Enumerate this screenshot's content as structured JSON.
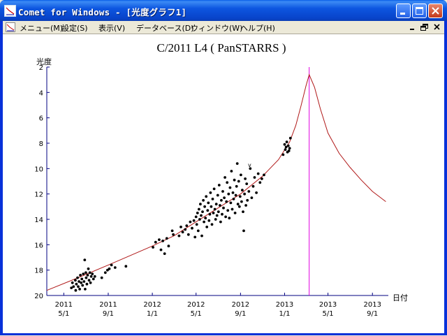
{
  "window": {
    "title": "Comet for Windows - [光度グラフ1]",
    "controls": {
      "minimize": "minimize",
      "maximize": "maximize",
      "close": "close"
    }
  },
  "menubar": {
    "items": [
      {
        "label": "メニュー(M)"
      },
      {
        "label": "設定(S)"
      },
      {
        "label": "表示(V)"
      },
      {
        "label": "データベース(D)"
      },
      {
        "label": "ウィンドウ(W)"
      },
      {
        "label": "ヘルプ(H)"
      }
    ]
  },
  "chart_data": {
    "type": "scatter",
    "title": "C/2011 L4 ( PanSTARRS )",
    "ylabel": "光度",
    "xlabel": "日付",
    "y_inverted": true,
    "ylim": [
      20,
      2
    ],
    "y_ticks": [
      2,
      4,
      6,
      8,
      10,
      12,
      14,
      16,
      18,
      20
    ],
    "xlim": [
      "2011-03-15",
      "2013-10-15"
    ],
    "x_ticks": [
      {
        "date": "2011-05-01",
        "year": "2011",
        "md": "5/1"
      },
      {
        "date": "2011-09-01",
        "year": "2011",
        "md": "9/1"
      },
      {
        "date": "2012-01-01",
        "year": "2012",
        "md": "1/1"
      },
      {
        "date": "2012-05-01",
        "year": "2012",
        "md": "5/1"
      },
      {
        "date": "2012-09-01",
        "year": "2012",
        "md": "9/1"
      },
      {
        "date": "2013-01-01",
        "year": "2013",
        "md": "1/1"
      },
      {
        "date": "2013-05-01",
        "year": "2013",
        "md": "5/1"
      },
      {
        "date": "2013-09-01",
        "year": "2013",
        "md": "9/1"
      }
    ],
    "perihelion_marker": {
      "date": "2013-03-10",
      "color": "#E000E0"
    },
    "curve": {
      "color": "#B01818",
      "points": [
        {
          "x": "2011-03-15",
          "y": 19.6
        },
        {
          "x": "2011-06-01",
          "y": 18.7
        },
        {
          "x": "2011-09-01",
          "y": 17.6
        },
        {
          "x": "2012-01-01",
          "y": 16.1
        },
        {
          "x": "2012-03-01",
          "y": 15.3
        },
        {
          "x": "2012-05-01",
          "y": 14.2
        },
        {
          "x": "2012-07-01",
          "y": 13.1
        },
        {
          "x": "2012-09-01",
          "y": 12.0
        },
        {
          "x": "2012-11-01",
          "y": 10.6
        },
        {
          "x": "2012-12-15",
          "y": 9.3
        },
        {
          "x": "2013-01-15",
          "y": 7.9
        },
        {
          "x": "2013-02-01",
          "y": 6.6
        },
        {
          "x": "2013-02-15",
          "y": 5.1
        },
        {
          "x": "2013-03-01",
          "y": 3.5
        },
        {
          "x": "2013-03-10",
          "y": 2.6
        },
        {
          "x": "2013-03-25",
          "y": 3.6
        },
        {
          "x": "2013-04-10",
          "y": 5.3
        },
        {
          "x": "2013-05-01",
          "y": 7.2
        },
        {
          "x": "2013-06-01",
          "y": 8.8
        },
        {
          "x": "2013-07-01",
          "y": 9.9
        },
        {
          "x": "2013-08-01",
          "y": 10.9
        },
        {
          "x": "2013-09-01",
          "y": 11.8
        },
        {
          "x": "2013-10-08",
          "y": 12.6
        }
      ]
    },
    "observations": [
      {
        "x": "2011-05-22",
        "y": 19.4
      },
      {
        "x": "2011-05-25",
        "y": 19.0
      },
      {
        "x": "2011-05-28",
        "y": 19.3
      },
      {
        "x": "2011-06-02",
        "y": 18.8
      },
      {
        "x": "2011-06-03",
        "y": 19.6
      },
      {
        "x": "2011-06-05",
        "y": 19.1
      },
      {
        "x": "2011-06-08",
        "y": 18.6
      },
      {
        "x": "2011-06-10",
        "y": 19.3
      },
      {
        "x": "2011-06-12",
        "y": 18.9
      },
      {
        "x": "2011-06-14",
        "y": 19.5
      },
      {
        "x": "2011-06-16",
        "y": 18.4
      },
      {
        "x": "2011-06-18",
        "y": 19.0
      },
      {
        "x": "2011-06-20",
        "y": 18.7
      },
      {
        "x": "2011-06-22",
        "y": 19.2
      },
      {
        "x": "2011-06-24",
        "y": 18.3
      },
      {
        "x": "2011-06-26",
        "y": 18.9
      },
      {
        "x": "2011-06-28",
        "y": 17.2
      },
      {
        "x": "2011-06-29",
        "y": 19.5
      },
      {
        "x": "2011-07-01",
        "y": 18.2
      },
      {
        "x": "2011-07-02",
        "y": 18.6
      },
      {
        "x": "2011-07-04",
        "y": 19.1
      },
      {
        "x": "2011-07-06",
        "y": 18.4
      },
      {
        "x": "2011-07-08",
        "y": 17.9
      },
      {
        "x": "2011-07-10",
        "y": 18.8
      },
      {
        "x": "2011-07-12",
        "y": 18.2
      },
      {
        "x": "2011-07-14",
        "y": 19.0
      },
      {
        "x": "2011-07-16",
        "y": 18.5
      },
      {
        "x": "2011-07-19",
        "y": 18.3
      },
      {
        "x": "2011-07-22",
        "y": 18.7
      },
      {
        "x": "2011-07-26",
        "y": 18.5
      },
      {
        "x": "2011-08-14",
        "y": 18.6
      },
      {
        "x": "2011-08-24",
        "y": 18.2
      },
      {
        "x": "2011-08-30",
        "y": 18.0
      },
      {
        "x": "2011-09-04",
        "y": 17.9
      },
      {
        "x": "2011-09-10",
        "y": 17.6
      },
      {
        "x": "2011-09-20",
        "y": 17.8
      },
      {
        "x": "2011-10-20",
        "y": 17.7
      },
      {
        "x": "2012-01-03",
        "y": 16.2
      },
      {
        "x": "2012-01-10",
        "y": 15.8
      },
      {
        "x": "2012-01-20",
        "y": 15.6
      },
      {
        "x": "2012-01-25",
        "y": 16.4
      },
      {
        "x": "2012-01-30",
        "y": 15.7
      },
      {
        "x": "2012-02-04",
        "y": 16.7
      },
      {
        "x": "2012-02-10",
        "y": 15.5
      },
      {
        "x": "2012-02-15",
        "y": 16.1
      },
      {
        "x": "2012-02-25",
        "y": 14.9
      },
      {
        "x": "2012-02-28",
        "y": 15.2
      },
      {
        "x": "2012-03-15",
        "y": 15.3
      },
      {
        "x": "2012-03-20",
        "y": 14.6
      },
      {
        "x": "2012-03-25",
        "y": 15.0
      },
      {
        "x": "2012-04-01",
        "y": 14.8
      },
      {
        "x": "2012-04-05",
        "y": 14.5
      },
      {
        "x": "2012-04-10",
        "y": 15.2
      },
      {
        "x": "2012-04-15",
        "y": 14.2
      },
      {
        "x": "2012-04-20",
        "y": 14.7
      },
      {
        "x": "2012-04-25",
        "y": 14.1
      },
      {
        "x": "2012-04-28",
        "y": 15.4
      },
      {
        "x": "2012-05-01",
        "y": 13.8
      },
      {
        "x": "2012-05-03",
        "y": 14.4
      },
      {
        "x": "2012-05-05",
        "y": 13.5
      },
      {
        "x": "2012-05-07",
        "y": 14.9
      },
      {
        "x": "2012-05-09",
        "y": 13.2
      },
      {
        "x": "2012-05-11",
        "y": 14.0
      },
      {
        "x": "2012-05-13",
        "y": 12.8
      },
      {
        "x": "2012-05-15",
        "y": 13.7
      },
      {
        "x": "2012-05-17",
        "y": 15.3
      },
      {
        "x": "2012-05-19",
        "y": 13.4
      },
      {
        "x": "2012-05-21",
        "y": 12.5
      },
      {
        "x": "2012-05-23",
        "y": 14.2
      },
      {
        "x": "2012-05-25",
        "y": 13.0
      },
      {
        "x": "2012-05-27",
        "y": 13.9
      },
      {
        "x": "2012-05-29",
        "y": 12.2
      },
      {
        "x": "2012-05-31",
        "y": 14.6
      },
      {
        "x": "2012-06-02",
        "y": 13.3
      },
      {
        "x": "2012-06-04",
        "y": 12.7
      },
      {
        "x": "2012-06-06",
        "y": 14.1
      },
      {
        "x": "2012-06-08",
        "y": 13.6
      },
      {
        "x": "2012-06-10",
        "y": 11.9
      },
      {
        "x": "2012-06-12",
        "y": 13.0
      },
      {
        "x": "2012-06-14",
        "y": 14.4
      },
      {
        "x": "2012-06-16",
        "y": 12.4
      },
      {
        "x": "2012-06-18",
        "y": 13.5
      },
      {
        "x": "2012-06-20",
        "y": 11.6
      },
      {
        "x": "2012-06-22",
        "y": 13.2
      },
      {
        "x": "2012-06-24",
        "y": 14.0
      },
      {
        "x": "2012-06-26",
        "y": 12.8
      },
      {
        "x": "2012-06-28",
        "y": 13.7
      },
      {
        "x": "2012-06-30",
        "y": 12.1
      },
      {
        "x": "2012-07-02",
        "y": 13.4
      },
      {
        "x": "2012-07-04",
        "y": 11.3
      },
      {
        "x": "2012-07-06",
        "y": 12.9
      },
      {
        "x": "2012-07-08",
        "y": 14.2
      },
      {
        "x": "2012-07-10",
        "y": 12.5
      },
      {
        "x": "2012-07-12",
        "y": 13.6
      },
      {
        "x": "2012-07-14",
        "y": 11.8
      },
      {
        "x": "2012-07-16",
        "y": 13.1
      },
      {
        "x": "2012-07-18",
        "y": 12.3
      },
      {
        "x": "2012-07-20",
        "y": 10.7
      },
      {
        "x": "2012-07-22",
        "y": 13.8
      },
      {
        "x": "2012-07-24",
        "y": 12.6
      },
      {
        "x": "2012-07-26",
        "y": 11.1
      },
      {
        "x": "2012-07-28",
        "y": 13.3
      },
      {
        "x": "2012-07-30",
        "y": 12.0
      },
      {
        "x": "2012-08-01",
        "y": 13.9
      },
      {
        "x": "2012-08-03",
        "y": 11.5
      },
      {
        "x": "2012-08-05",
        "y": 12.7
      },
      {
        "x": "2012-08-07",
        "y": 10.2
      },
      {
        "x": "2012-08-09",
        "y": 13.2
      },
      {
        "x": "2012-08-11",
        "y": 11.9
      },
      {
        "x": "2012-08-13",
        "y": 12.4
      },
      {
        "x": "2012-08-15",
        "y": 10.9
      },
      {
        "x": "2012-08-17",
        "y": 13.5
      },
      {
        "x": "2012-08-19",
        "y": 12.1
      },
      {
        "x": "2012-08-21",
        "y": 11.4
      },
      {
        "x": "2012-08-23",
        "y": 9.6
      },
      {
        "x": "2012-08-25",
        "y": 12.8
      },
      {
        "x": "2012-08-27",
        "y": 11.0
      },
      {
        "x": "2012-08-29",
        "y": 13.0
      },
      {
        "x": "2012-08-31",
        "y": 12.2
      },
      {
        "x": "2012-09-02",
        "y": 10.5
      },
      {
        "x": "2012-09-04",
        "y": 12.6
      },
      {
        "x": "2012-09-06",
        "y": 11.7
      },
      {
        "x": "2012-09-08",
        "y": 13.4
      },
      {
        "x": "2012-09-10",
        "y": 14.9
      },
      {
        "x": "2012-09-12",
        "y": 12.0
      },
      {
        "x": "2012-09-14",
        "y": 10.8
      },
      {
        "x": "2012-09-16",
        "y": 12.9
      },
      {
        "x": "2012-09-18",
        "y": 11.2
      },
      {
        "x": "2012-09-20",
        "y": 12.5
      },
      {
        "x": "2012-09-24",
        "y": 11.8
      },
      {
        "x": "2012-09-28",
        "y": 10.0
      },
      {
        "x": "2012-10-02",
        "y": 12.3
      },
      {
        "x": "2012-10-06",
        "y": 11.4
      },
      {
        "x": "2012-10-10",
        "y": 10.7
      },
      {
        "x": "2012-10-15",
        "y": 11.9
      },
      {
        "x": "2012-10-20",
        "y": 10.4
      },
      {
        "x": "2012-10-25",
        "y": 11.1
      },
      {
        "x": "2012-10-30",
        "y": 10.8
      },
      {
        "x": "2012-11-05",
        "y": 10.5
      },
      {
        "x": "2012-12-28",
        "y": 8.9
      },
      {
        "x": "2013-01-01",
        "y": 8.1
      },
      {
        "x": "2013-01-03",
        "y": 8.5
      },
      {
        "x": "2013-01-05",
        "y": 8.3
      },
      {
        "x": "2013-01-07",
        "y": 7.9
      },
      {
        "x": "2013-01-09",
        "y": 8.7
      },
      {
        "x": "2013-01-11",
        "y": 8.2
      },
      {
        "x": "2013-01-13",
        "y": 8.6
      },
      {
        "x": "2013-01-15",
        "y": 8.4
      },
      {
        "x": "2013-01-17",
        "y": 7.6
      }
    ]
  }
}
